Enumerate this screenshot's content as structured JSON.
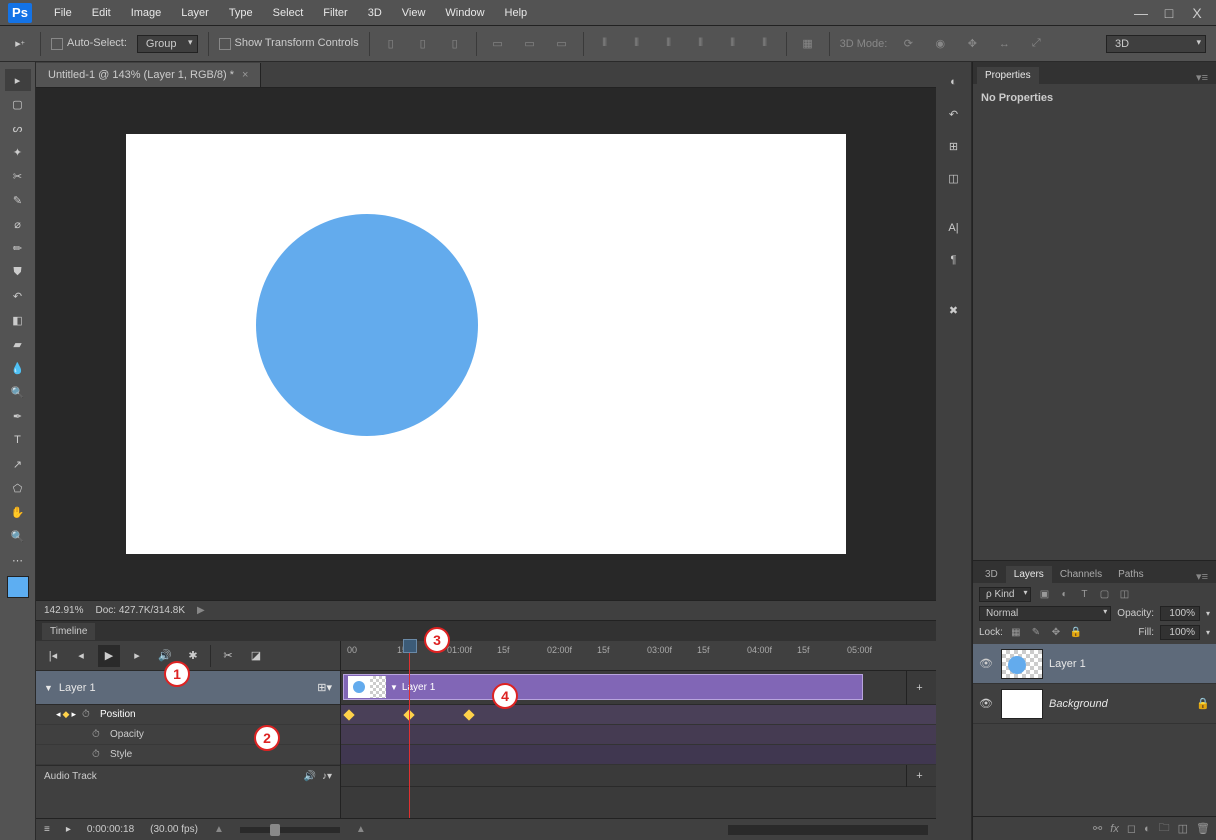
{
  "menubar": {
    "logo": "Ps",
    "items": [
      "File",
      "Edit",
      "Image",
      "Layer",
      "Type",
      "Select",
      "Filter",
      "3D",
      "View",
      "Window",
      "Help"
    ]
  },
  "window_controls": {
    "min": "—",
    "max": "□",
    "close": "X"
  },
  "optionsbar": {
    "auto_select": "Auto-Select:",
    "group_dd": "Group",
    "show_transform": "Show Transform Controls",
    "mode_label": "3D Mode:",
    "view_dd": "3D"
  },
  "doc": {
    "tab_title": "Untitled-1 @ 143% (Layer 1, RGB/8) *",
    "zoom": "142.91%",
    "doc_size": "Doc: 427.7K/314.8K"
  },
  "timeline": {
    "tab": "Timeline",
    "ruler": [
      "00",
      "15f",
      "01:00f",
      "15f",
      "02:00f",
      "15f",
      "03:00f",
      "15f",
      "04:00f",
      "15f",
      "05:00f"
    ],
    "layer_name": "Layer 1",
    "clip_label": "Layer 1",
    "props": {
      "position": "Position",
      "opacity": "Opacity",
      "style": "Style"
    },
    "audio": "Audio Track",
    "timecode": "0:00:00:18",
    "fps": "(30.00 fps)"
  },
  "properties": {
    "tab": "Properties",
    "empty": "No Properties"
  },
  "layers_panel": {
    "tabs": [
      "3D",
      "Layers",
      "Channels",
      "Paths"
    ],
    "kind": "Kind",
    "blend": "Normal",
    "opacity_label": "Opacity:",
    "opacity_val": "100%",
    "lock_label": "Lock:",
    "fill_label": "Fill:",
    "fill_val": "100%",
    "items": [
      {
        "name": "Layer 1",
        "selected": true,
        "locked": false
      },
      {
        "name": "Background",
        "selected": false,
        "locked": true
      }
    ]
  },
  "annotations": {
    "b1": "1",
    "b2": "2",
    "b3": "3",
    "b4": "4"
  }
}
